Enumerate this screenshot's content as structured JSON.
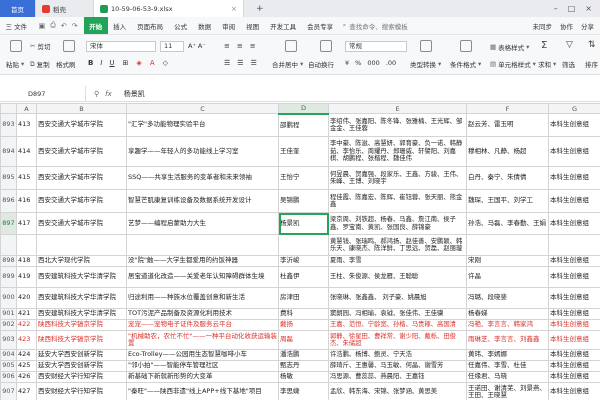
{
  "tabs": [
    {
      "label": "首页",
      "type": "home"
    },
    {
      "label": "稻壳",
      "type": "find"
    },
    {
      "label": "10-59-06-53-9.xlsx",
      "type": "doc"
    }
  ],
  "menubar": {
    "file_label": "三 文件",
    "items": [
      "开始",
      "插入",
      "页面布局",
      "公式",
      "数据",
      "审阅",
      "视图",
      "开发工具",
      "会员专享"
    ],
    "active": "开始",
    "search_placeholder": "查找命令、搜索模板",
    "right": [
      "未同步",
      "协作",
      "分享"
    ]
  },
  "ribbon": {
    "cut": "剪切",
    "copy": "复制",
    "paste": "粘贴",
    "format_painter": "格式刷",
    "font": "宋体",
    "size": "11",
    "merge": "合并居中",
    "wrap": "自动换行",
    "number_format": "常规",
    "type_convert": "类型转换",
    "cond_format": "条件格式",
    "table_style": "表格样式",
    "cell_style": "单元格样式",
    "sum": "求和",
    "filter": "筛选",
    "sort": "排序"
  },
  "formula_bar": {
    "name_box": "D897",
    "fx": "fx",
    "value": "杨景凯"
  },
  "columns": [
    "A",
    "B",
    "C",
    "D",
    "E",
    "F",
    "G"
  ],
  "selected_column": "D",
  "rows": [
    {
      "rn": "893",
      "a": "413",
      "b": "西安交通大学城市学院",
      "c": "\"汇学\"多功能物理实验平台",
      "d": "邵鹏程",
      "e": "李绍伟、张嘉阳、陈冬锋、张雅楠、王光辉、邹金金、王佳蓉",
      "f": "赵云芳、雷玉明",
      "g": "本科生创意组"
    },
    {
      "rn": "894",
      "a": "414",
      "b": "西安交通大学城市学院",
      "c": "享趣学——年轻人的多功能线上学习室",
      "d": "王佳奎",
      "e": "李中豪、陈滋、高慧妍、郭育豪、负一诺、韩静茹、李怡乐、周耀丹、郑珊威、轩譬阳、刘嘉棋、胡鹏程、张楷程、魏佳伟",
      "f": "穆相林、凡静、杨超",
      "g": "本科生创意组"
    },
    {
      "rn": "895",
      "a": "415",
      "b": "西安交通大学城市学院",
      "c": "SSQ——共享生活服务的变革者和未来领袖",
      "d": "王怡宁",
      "e": "何昱晨、贺嘉强、段家乐、王鑫、方骏、王伟、朱峰、王博、刘晓宇",
      "f": "白丹、秦宁、朱倩倩",
      "g": "本科生创意组"
    },
    {
      "rn": "896",
      "a": "416",
      "b": "西安交通大学城市学院",
      "c": "智慧芒肌康复训练设备及数据系统开发设计",
      "d": "吴锦鹏",
      "e": "程佳霞、陈嘉宏、陈辉、崔钰蓉、张天丽、熊金鑫",
      "f": "魏琛、王国平、刘学工",
      "g": "本科生创意组"
    },
    {
      "rn": "897",
      "a": "417",
      "b": "西安交通大学城市学院",
      "c": "艺梦——编程启蒙助力大生",
      "d": "杨景凯",
      "e": "梁京周、刘铁超、杨春、马鑫、詹江南、侯子鑫、罗宝南、黄凯、张国良、薛锦豪",
      "f": "孙浩、马磊、李春勤、王娟",
      "g": "本科生创意组"
    },
    {
      "rn": "",
      "a": "",
      "b": "",
      "c": "",
      "d": "",
      "e": "黄慧钱、张瑞鸣、郝鸿扬、赵佳善、安鹏颖、韩乐天、康晓杰、陈洋鲜、丁思远、贺磊、赵丽璇",
      "f": "",
      "g": ""
    },
    {
      "rn": "898",
      "a": "418",
      "b": "西北大学现代学院",
      "c": "没\"院\"触——大学生都爱用的约饭神器",
      "d": "李沂峻",
      "e": "夏雨、李雪",
      "f": "宋刚",
      "g": "本科生创意组"
    },
    {
      "rn": "899",
      "a": "419",
      "b": "西安建筑科技大学华清学院",
      "c": "居宝道道化改造——关爱老年认知障碍群体生境",
      "d": "杜鑫伊",
      "e": "王柱、朱俊源、侯龙雁、王聪聪",
      "f": "许晶",
      "g": "本科生创意组"
    },
    {
      "rn": "900",
      "a": "420",
      "b": "西安建筑科技大学华清学院",
      "c": "归途利用——种族水位覆盖创意和新生活",
      "d": "房津田",
      "e": "张晓琳、张鑫鑫、 刘子豪、姚晨旭",
      "f": "冯璐、段晓斐",
      "g": "本科生创意组"
    },
    {
      "rn": "901",
      "a": "421",
      "b": "西安建筑科技大学华清学院",
      "c": "TOT污泥产品制备及资源化利用技术",
      "d": "费科",
      "e": "窦朗园、冯相瑜、袁钺、张佳伟、王佳骥",
      "f": "杨春娣",
      "g": "本科生创意组"
    },
    {
      "rn": "902",
      "a": "422",
      "b": "陕西科技大学镐京学院",
      "c": "宠宠——宠物电子证件及服务云平台",
      "d": "戴扬",
      "e": "王嘉、范恒、宁龄宽、孙楷、马贵稼、高国清",
      "f": "冯艳、李言言、韩家鸿",
      "g": "本科生创意组",
      "red": true
    },
    {
      "rn": "903",
      "a": "423",
      "b": "陕西科技大学镐京学院",
      "c": "\"机械助农，农忙不忙\"——一种平台动化收获运输装置",
      "d": "周磊",
      "e": "郭静、徐星田、曹祥常、谢少阳、戴栎、田俊杰、朱储超",
      "f": "雨琳芝、李言言、刘鑫鑫",
      "g": "本科生创意组",
      "red": true
    },
    {
      "rn": "904",
      "a": "424",
      "b": "延安大学西安创新学院",
      "c": "Eco-Trolley——公园用生态智慧咖啡小车",
      "d": "潘浩鹏",
      "e": "许浩鹏、杨博、鲍灵、宁天浩",
      "f": "黄玮、李嫣娜",
      "g": "本科生创意组"
    },
    {
      "rn": "905",
      "a": "425",
      "b": "延安大学西安创新学院",
      "c": "\"邻小拍\"——智能停车管理社区",
      "d": "甄志丹",
      "e": "薛琦斤、王惠馨、马玉敏、何晶、谢雪芳",
      "f": "任嘉伟、李雪、杜佳",
      "g": "本科生创意组"
    },
    {
      "rn": "906",
      "a": "426",
      "b": "西安财经大学行知学院",
      "c": "新基础下新就新形势的大变革",
      "d": "杨敏",
      "e": "冯思源、曹蕊蕊、燕晨阳、王嘉钰",
      "f": "任缘君、马晓",
      "g": "本科生创意组"
    },
    {
      "rn": "907",
      "a": "427",
      "b": "西安财经大学行知学院",
      "c": "\"秦旺\"——陕西非遗\"线上APP+线下基地\"项目",
      "d": "李思婕",
      "e": "孟欣、韩东海、宋锦、张梦涵、黄思美",
      "f": "王诺田、谢清芜、刘景燕、王田、王晓慧",
      "g": "本科生创意组"
    }
  ]
}
